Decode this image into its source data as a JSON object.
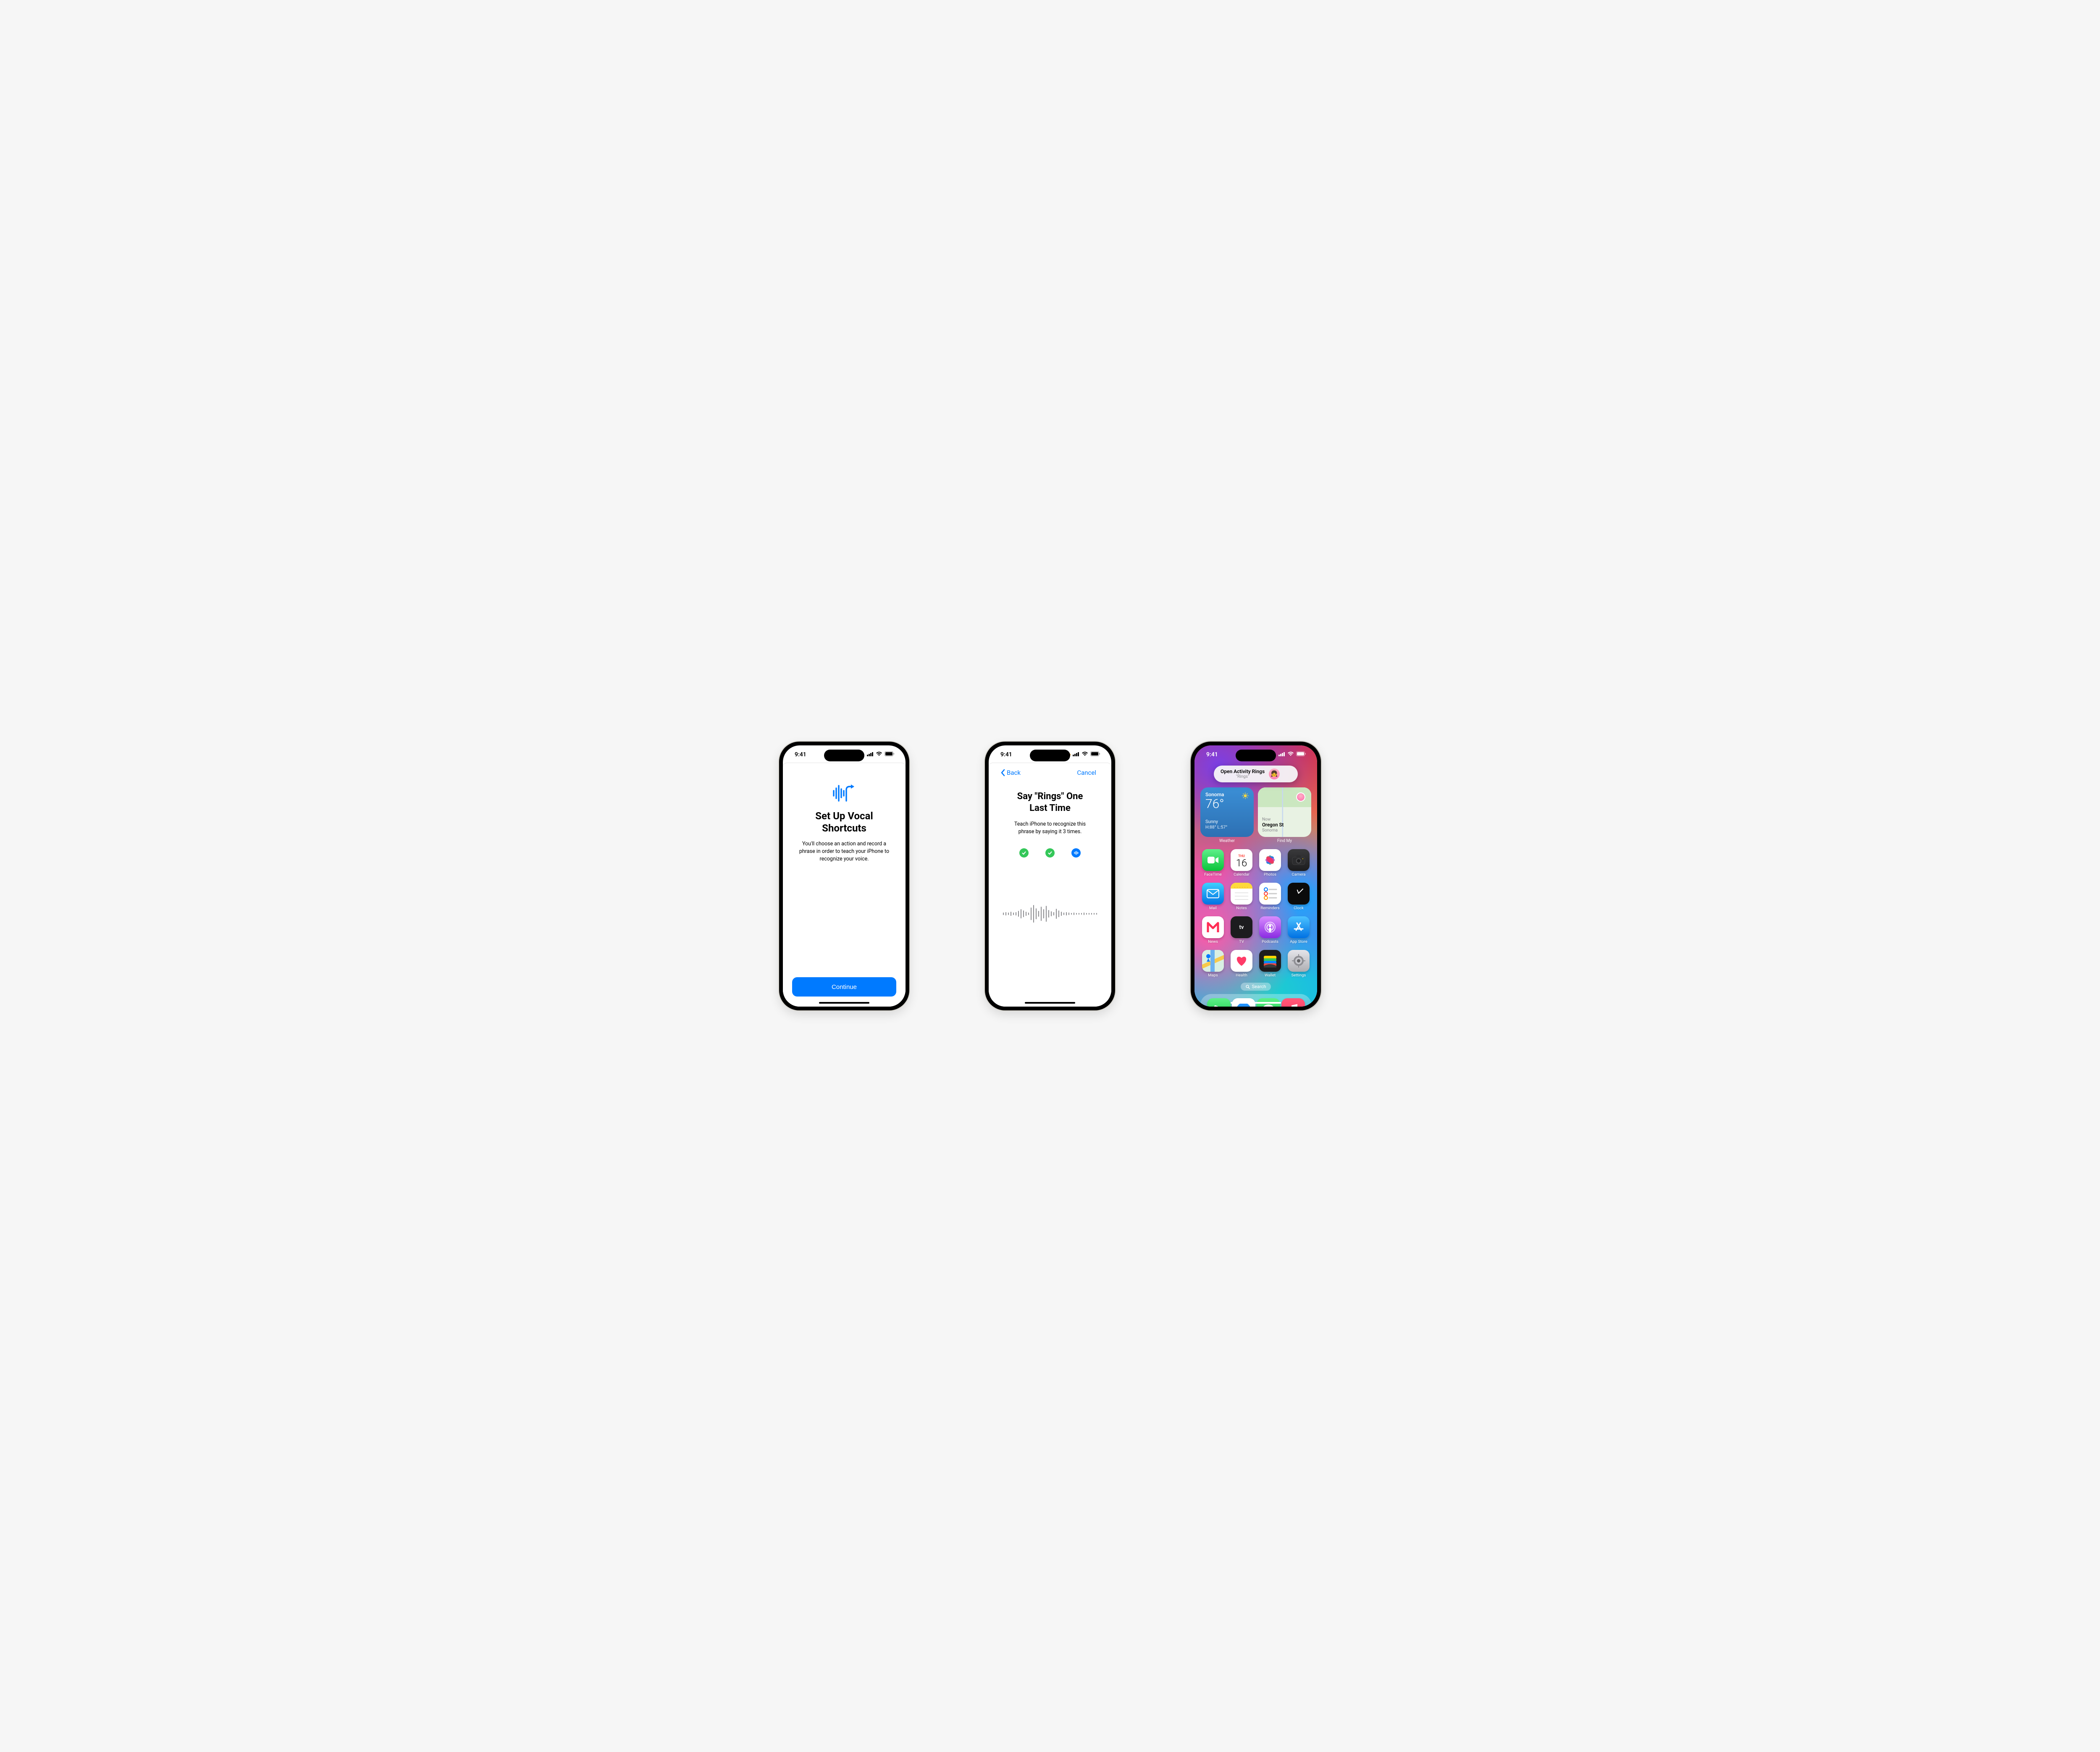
{
  "status": {
    "time": "9:41"
  },
  "screen1": {
    "title": "Set Up Vocal Shortcuts",
    "subtitle": "You'll choose an action and record a phrase in order to teach your iPhone to recognize your voice.",
    "continue": "Continue"
  },
  "screen2": {
    "back": "Back",
    "cancel": "Cancel",
    "title": "Say \"Rings\" One Last Time",
    "subtitle": "Teach iPhone to recognize this phrase by saying it 3 times."
  },
  "screen3": {
    "banner": {
      "title": "Open Activity Rings",
      "sub": "\"Rings\""
    },
    "weather": {
      "city": "Sonoma",
      "temp": "76°",
      "cond": "Sunny",
      "hl": "H:88° L:57°",
      "caption": "Weather"
    },
    "findmy": {
      "now": "Now",
      "loc": "Oregon St",
      "sub": "Sonoma",
      "caption": "Find My"
    },
    "search": "Search",
    "cal": {
      "dow": "THU",
      "day": "16"
    },
    "apps": {
      "facetime": "FaceTime",
      "calendar": "Calendar",
      "photos": "Photos",
      "camera": "Camera",
      "mail": "Mail",
      "notes": "Notes",
      "reminders": "Reminders",
      "clock": "Clock",
      "news": "News",
      "tv": "TV",
      "podcasts": "Podcasts",
      "appstore": "App Store",
      "maps": "Maps",
      "health": "Health",
      "wallet": "Wallet",
      "settings": "Settings"
    }
  }
}
